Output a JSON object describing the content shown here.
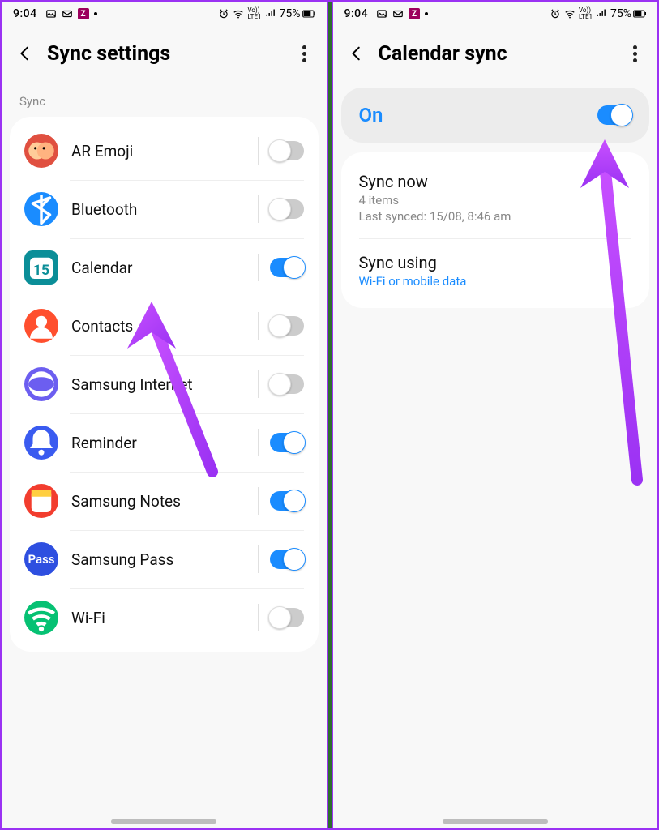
{
  "screens": {
    "left": {
      "status": {
        "time": "9:04",
        "battery": "75%",
        "lte": "LTE1",
        "vo": "Vo))"
      },
      "header": {
        "title": "Sync settings"
      },
      "section": "Sync",
      "items": [
        {
          "label": "AR Emoji",
          "on": false,
          "iconBg": "#e05040",
          "iconTxt": ""
        },
        {
          "label": "Bluetooth",
          "on": false,
          "iconBg": "#1a8cff",
          "iconTxt": ""
        },
        {
          "label": "Calendar",
          "on": true,
          "iconBg": "#0b8e98",
          "iconTxt": "15"
        },
        {
          "label": "Contacts",
          "on": false,
          "iconBg": "#ff4f2e",
          "iconTxt": ""
        },
        {
          "label": "Samsung Internet",
          "on": false,
          "iconBg": "#6c5ef0",
          "iconTxt": ""
        },
        {
          "label": "Reminder",
          "on": true,
          "iconBg": "#3a5bf0",
          "iconTxt": ""
        },
        {
          "label": "Samsung Notes",
          "on": true,
          "iconBg": "#f23d2e",
          "iconTxt": ""
        },
        {
          "label": "Samsung Pass",
          "on": true,
          "iconBg": "#2e4fe0",
          "iconTxt": "Pass"
        },
        {
          "label": "Wi-Fi",
          "on": false,
          "iconBg": "#06c173",
          "iconTxt": ""
        }
      ]
    },
    "right": {
      "status": {
        "time": "9:04",
        "battery": "75%",
        "lte": "LTE1",
        "vo": "Vo))"
      },
      "header": {
        "title": "Calendar sync"
      },
      "master": {
        "label": "On",
        "on": true
      },
      "syncNow": {
        "title": "Sync now",
        "sub1": "4 items",
        "sub2": "Last synced: 15/08, 8:46 am"
      },
      "syncUsing": {
        "title": "Sync using",
        "sub": "Wi-Fi or mobile data"
      }
    }
  }
}
